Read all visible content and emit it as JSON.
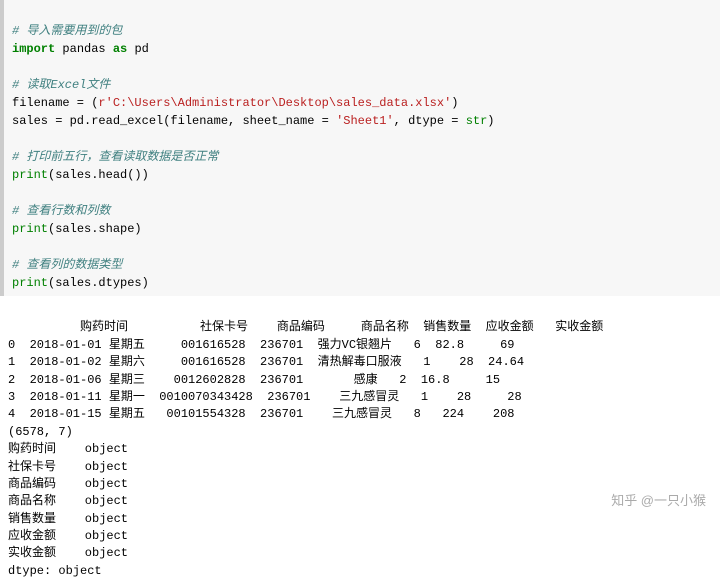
{
  "code": {
    "c1": "# 导入需要用到的包",
    "l1a": "import",
    "l1b": "pandas",
    "l1c": "as",
    "l1d": "pd",
    "c2": "# 读取Excel文件",
    "l2a": "filename = (",
    "l2b": "r'C:\\Users\\Administrator\\Desktop\\sales_data.xlsx'",
    "l2c": ")",
    "l3a": "sales = pd.read_excel(filename, sheet_name = ",
    "l3b": "'Sheet1'",
    "l3c": ", dtype = ",
    "l3d": "str",
    "l3e": ")",
    "c3": "# 打印前五行，查看读取数据是否正常",
    "l4a": "print",
    "l4b": "(sales.head())",
    "c4": "# 查看行数和列数",
    "l5a": "print",
    "l5b": "(sales.shape)",
    "c5": "# 查看列的数据类型",
    "l6a": "print",
    "l6b": "(sales.dtypes)"
  },
  "chart_data": {
    "type": "table",
    "columns": [
      "购药时间",
      "社保卡号",
      "商品编码",
      "商品名称",
      "销售数量",
      "应收金额",
      "实收金额"
    ],
    "rows": [
      {
        "idx": 0,
        "购药时间": "2018-01-01 星期五",
        "社保卡号": "001616528",
        "商品编码": "236701",
        "商品名称": "强力VC银翘片",
        "销售数量": 6,
        "应收金额": 82.8,
        "实收金额": 69
      },
      {
        "idx": 1,
        "购药时间": "2018-01-02 星期六",
        "社保卡号": "001616528",
        "商品编码": "236701",
        "商品名称": "清热解毒口服液",
        "销售数量": 1,
        "应收金额": 28,
        "实收金额": 24.64
      },
      {
        "idx": 2,
        "购药时间": "2018-01-06 星期三",
        "社保卡号": "0012602828",
        "商品编码": "236701",
        "商品名称": "感康",
        "销售数量": 2,
        "应收金额": 16.8,
        "实收金额": 15
      },
      {
        "idx": 3,
        "购药时间": "2018-01-11 星期一",
        "社保卡号": "0010070343428",
        "商品编码": "236701",
        "商品名称": "三九感冒灵",
        "销售数量": 1,
        "应收金额": 28,
        "实收金额": 28
      },
      {
        "idx": 4,
        "购药时间": "2018-01-15 星期五",
        "社保卡号": "00101554328",
        "商品编码": "236701",
        "商品名称": "三九感冒灵",
        "销售数量": 8,
        "应收金额": 224,
        "实收金额": 208
      }
    ],
    "shape": "(6578, 7)",
    "dtypes": [
      {
        "col": "购药时间",
        "type": "object"
      },
      {
        "col": "社保卡号",
        "type": "object"
      },
      {
        "col": "商品编码",
        "type": "object"
      },
      {
        "col": "商品名称",
        "type": "object"
      },
      {
        "col": "销售数量",
        "type": "object"
      },
      {
        "col": "应收金额",
        "type": "object"
      },
      {
        "col": "实收金额",
        "type": "object"
      }
    ],
    "dtype_footer": "dtype: object"
  },
  "output_text": {
    "header": "          购药时间          社保卡号    商品编码     商品名称  销售数量  应收金额   实收金额",
    "r0": "0  2018-01-01 星期五     001616528  236701  强力VC银翘片   6  82.8     69",
    "r1": "1  2018-01-02 星期六     001616528  236701  清热解毒口服液   1    28  24.64",
    "r2": "2  2018-01-06 星期三    0012602828  236701       感康   2  16.8     15",
    "r3": "3  2018-01-11 星期一  0010070343428  236701    三九感冒灵   1    28     28",
    "r4": "4  2018-01-15 星期五   00101554328  236701    三九感冒灵   8   224    208",
    "shape": "(6578, 7)",
    "d0": "购药时间    object",
    "d1": "社保卡号    object",
    "d2": "商品编码    object",
    "d3": "商品名称    object",
    "d4": "销售数量    object",
    "d5": "应收金额    object",
    "d6": "实收金额    object",
    "dfooter": "dtype: object"
  },
  "watermark": "知乎 @一只小猴"
}
